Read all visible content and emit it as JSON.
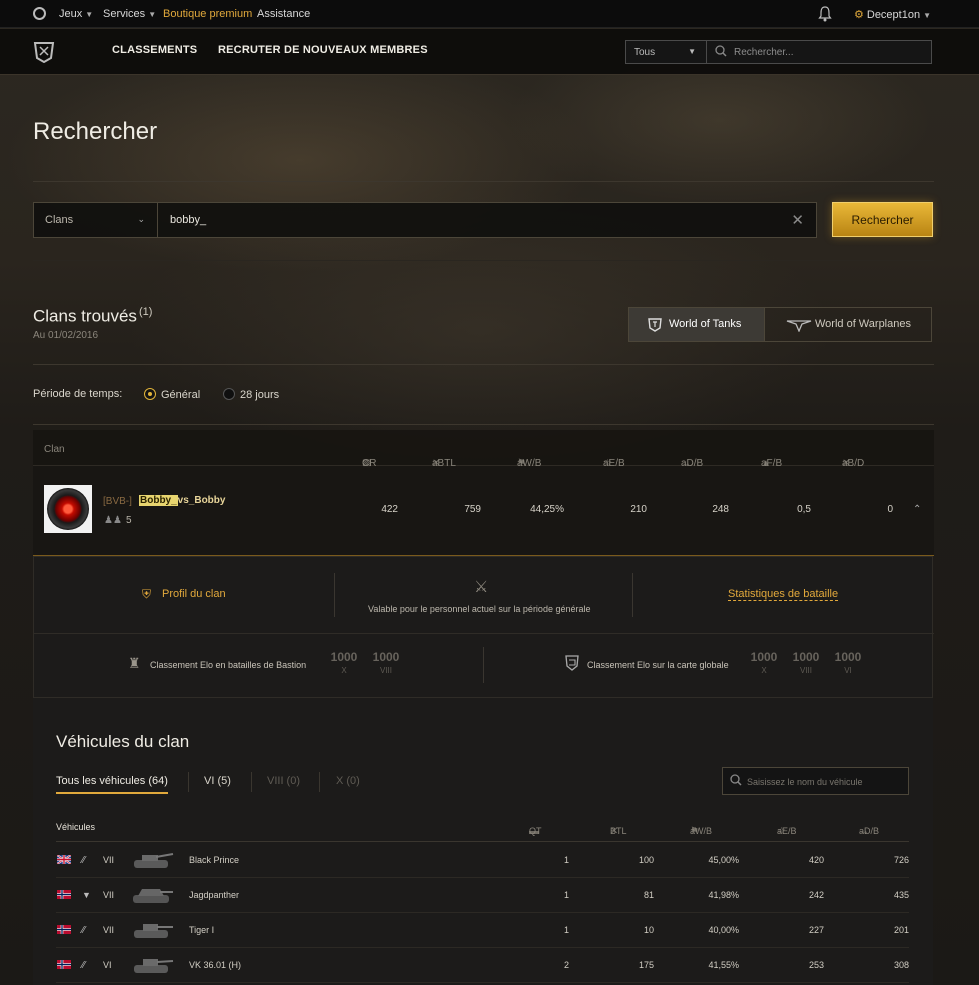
{
  "topbar": {
    "games": "Jeux",
    "services": "Services",
    "premium_shop": "Boutique premium",
    "support": "Assistance",
    "username": "Decept1on",
    "premium_color": "#e1a93c"
  },
  "nav": {
    "rankings": "CLASSEMENTS",
    "recruit": "RECRUTER DE NOUVEAUX MEMBRES",
    "filter_value": "Tous",
    "search_placeholder": "Rechercher..."
  },
  "page": {
    "title": "Rechercher",
    "search_type": "Clans",
    "search_value": "bobby_",
    "search_button": "Rechercher"
  },
  "results": {
    "title": "Clans trouvés",
    "count": "(1)",
    "date": "Au 01/02/2016",
    "game_tabs": [
      "World of Tanks",
      "World of Warplanes"
    ],
    "period_label": "Période de temps:",
    "period_options": [
      "Général",
      "28 jours"
    ],
    "period_selected": "Général"
  },
  "table": {
    "headers": [
      "Clan",
      "CR",
      "aBTL",
      "aW/B",
      "aE/B",
      "aD/B",
      "aF/B",
      "aB/D"
    ],
    "row": {
      "tag": "[BVB-]",
      "name_highlight": "Bobby_",
      "name_rest": "vs_Bobby",
      "members": "5",
      "values": [
        "422",
        "759",
        "44,25%",
        "210",
        "248",
        "0,5",
        "0"
      ]
    }
  },
  "details": {
    "profile_link": "Profil du clan",
    "valid_note": "Valable pour le personnel actuel sur la période générale",
    "stats_link": "Statistiques de bataille",
    "elo_bastion_label": "Classement Elo en batailles de Bastion",
    "elo_bastion": [
      {
        "value": "1000",
        "tier": "X"
      },
      {
        "value": "1000",
        "tier": "VIII"
      }
    ],
    "elo_map_label": "Classement Elo sur la carte globale",
    "elo_map": [
      {
        "value": "1000",
        "tier": "X"
      },
      {
        "value": "1000",
        "tier": "VIII"
      },
      {
        "value": "1000",
        "tier": "VI"
      }
    ]
  },
  "vehicles": {
    "title": "Véhicules du clan",
    "tabs": [
      "Tous les véhicules (64)",
      "VI (5)",
      "VIII (0)",
      "X (0)"
    ],
    "search_placeholder": "Saisissez le nom du véhicule",
    "headers": [
      "Véhicules",
      "QT",
      "BTL",
      "aW/B",
      "aE/B",
      "aD/B"
    ],
    "rows": [
      {
        "flag": "uk",
        "class_icon": "medium-tank-icon",
        "tier": "VII",
        "name": "Black Prince",
        "qt": "1",
        "btl": "100",
        "wb": "45,00%",
        "eb": "420",
        "db": "726"
      },
      {
        "flag": "norway",
        "class_icon": "td-icon",
        "tier": "VII",
        "name": "Jagdpanther",
        "qt": "1",
        "btl": "81",
        "wb": "41,98%",
        "eb": "242",
        "db": "435"
      },
      {
        "flag": "norway",
        "class_icon": "heavy-tank-icon",
        "tier": "VII",
        "name": "Tiger I",
        "qt": "1",
        "btl": "10",
        "wb": "40,00%",
        "eb": "227",
        "db": "201"
      },
      {
        "flag": "norway",
        "class_icon": "heavy-tank-icon",
        "tier": "VI",
        "name": "VK 36.01 (H)",
        "qt": "2",
        "btl": "175",
        "wb": "41,55%",
        "eb": "253",
        "db": "308"
      }
    ]
  }
}
